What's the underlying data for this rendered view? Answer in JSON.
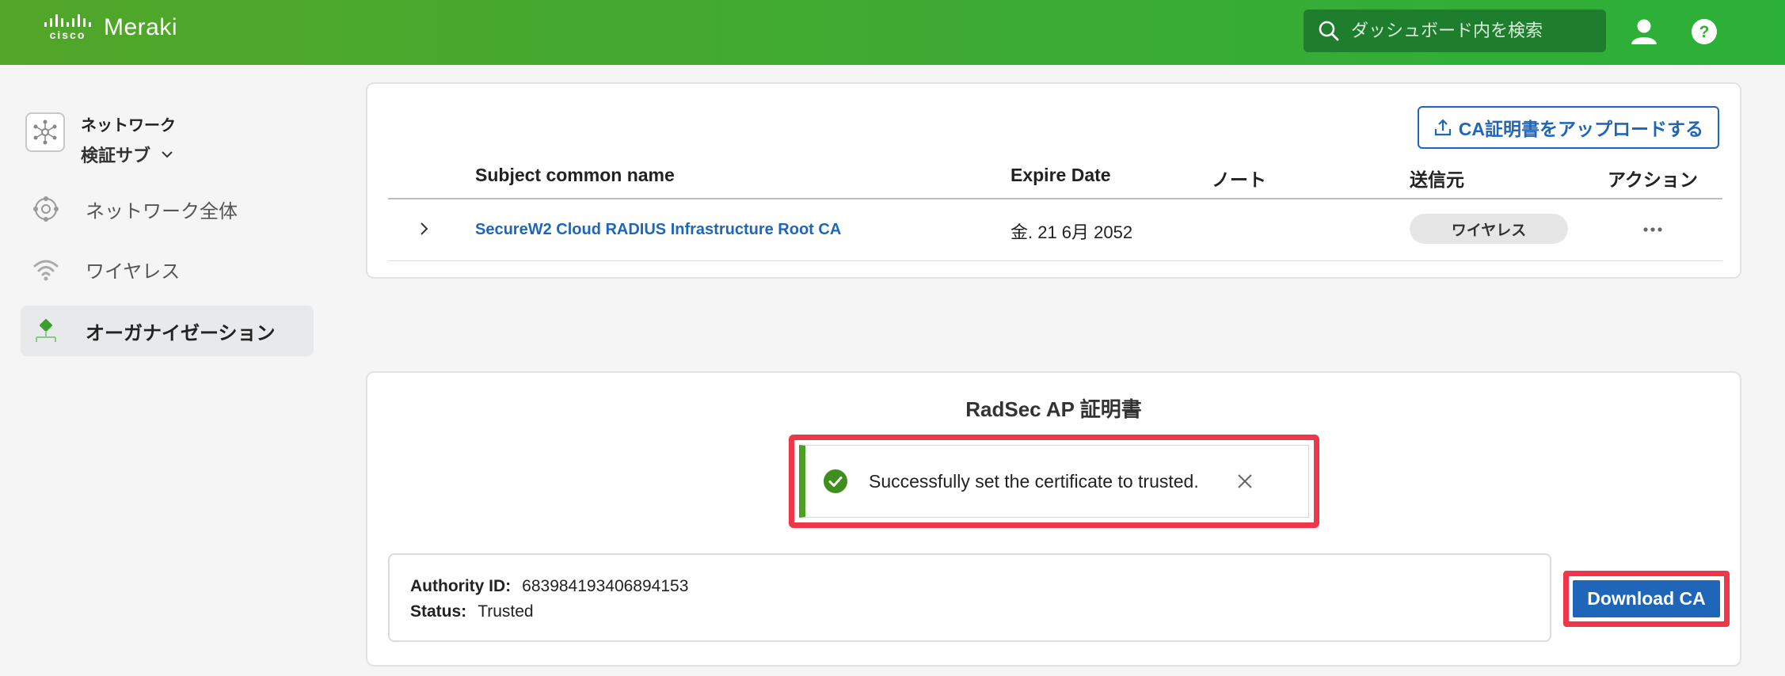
{
  "header": {
    "brand_cisco": "cisco",
    "brand_meraki": "Meraki",
    "search_placeholder": "ダッシュボード内を検索"
  },
  "sidebar": {
    "network_label": "ネットワーク",
    "network_name": "検証サブ",
    "items": [
      {
        "label": "ネットワーク全体",
        "icon": "network-wide-icon"
      },
      {
        "label": "ワイヤレス",
        "icon": "wireless-icon"
      },
      {
        "label": "オーガナイゼーション",
        "icon": "organization-icon",
        "active": true
      }
    ]
  },
  "ca_panel": {
    "upload_button": "CA証明書をアップロードする",
    "columns": [
      "Subject common name",
      "Expire Date",
      "ノート",
      "送信元",
      "アクション"
    ],
    "rows": [
      {
        "subject": "SecureW2 Cloud RADIUS Infrastructure Root CA",
        "expire": "金. 21 6月 2052",
        "note": "",
        "source": "ワイヤレス"
      }
    ]
  },
  "radsec_panel": {
    "title": "RadSec AP 証明書",
    "toast_message": "Successfully set the certificate to trusted.",
    "authority_label": "Authority ID:",
    "authority_value": "683984193406894153",
    "status_label": "Status:",
    "status_value": "Trusted",
    "download_button": "Download CA"
  },
  "colors": {
    "brand_green": "#3bab34",
    "link_blue": "#1f66b8",
    "highlight_red": "#f0364b",
    "success_green": "#4c9f25"
  }
}
